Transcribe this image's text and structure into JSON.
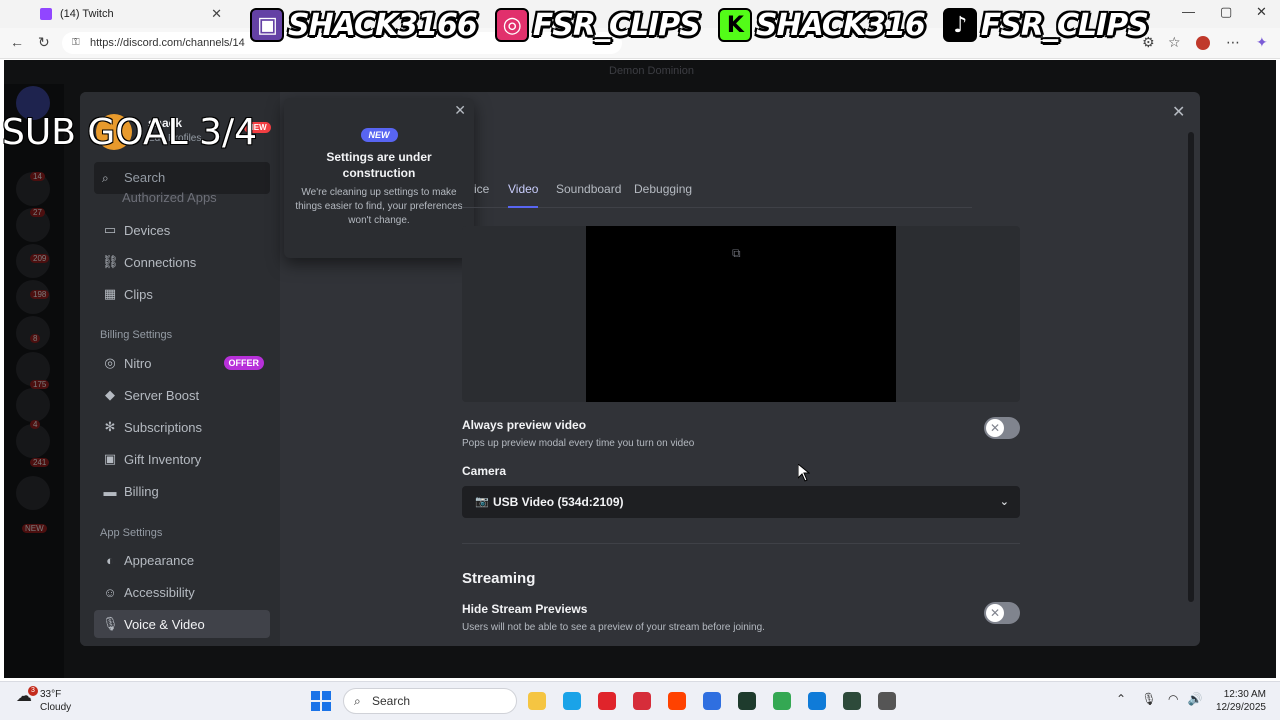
{
  "browser": {
    "tabs": [
      {
        "title": "(14) Twitch"
      }
    ],
    "url": "https://discord.com/channels/14"
  },
  "overlay": {
    "banner": [
      {
        "handle": "SHACK3166",
        "platform_icon": "twitch-icon",
        "color": "#6441a5"
      },
      {
        "handle": "FSR_CLIPS",
        "platform_icon": "instagram-icon",
        "color": "#e1306c"
      },
      {
        "handle": "SHACK316",
        "platform_icon": "kick-icon",
        "color": "#53fc18"
      },
      {
        "handle": "FSR_CLIPS",
        "platform_icon": "tiktok-icon",
        "color": "#000000"
      }
    ],
    "sub_goal": "SUB GOAL 3/4"
  },
  "discord": {
    "server_title": "Demon Dominion",
    "server_badges": [
      "14",
      "27",
      "209",
      "198",
      "8",
      "175",
      "4",
      "241",
      "NEW"
    ]
  },
  "settings": {
    "profile": {
      "name": "shack",
      "subtitle": "Edit Profiles",
      "new_label": "NEW"
    },
    "search_placeholder": "Search",
    "cut_item": "Authorized Apps",
    "nav_top": [
      {
        "label": "Devices",
        "icon": "devices-icon",
        "glyph": "▭"
      },
      {
        "label": "Connections",
        "icon": "link-icon",
        "glyph": "⛓"
      },
      {
        "label": "Clips",
        "icon": "clips-icon",
        "glyph": "▦"
      }
    ],
    "billing_section": "Billing Settings",
    "nav_billing": [
      {
        "label": "Nitro",
        "icon": "nitro-icon",
        "glyph": "◎",
        "badge": "OFFER"
      },
      {
        "label": "Server Boost",
        "icon": "boost-icon",
        "glyph": "◆"
      },
      {
        "label": "Subscriptions",
        "icon": "subscriptions-icon",
        "glyph": "✻"
      },
      {
        "label": "Gift Inventory",
        "icon": "gift-icon",
        "glyph": "▣"
      },
      {
        "label": "Billing",
        "icon": "card-icon",
        "glyph": "▬"
      }
    ],
    "app_section": "App Settings",
    "nav_app": [
      {
        "label": "Appearance",
        "icon": "palette-icon",
        "glyph": "◐"
      },
      {
        "label": "Accessibility",
        "icon": "accessibility-icon",
        "glyph": "☺"
      },
      {
        "label": "Voice & Video",
        "icon": "mic-icon",
        "glyph": "🎙",
        "active": true
      }
    ],
    "popover": {
      "badge": "NEW",
      "title": "Settings are under construction",
      "text": "We're cleaning up settings to make things easier to find, your preferences won't change."
    },
    "tabs": [
      {
        "label": "ice"
      },
      {
        "label": "Video",
        "active": true
      },
      {
        "label": "Soundboard"
      },
      {
        "label": "Debugging"
      }
    ],
    "always_preview": {
      "label": "Always preview video",
      "description": "Pops up preview modal every time you turn on video",
      "enabled": false
    },
    "camera": {
      "label": "Camera",
      "selected": "USB Video (534d:2109)"
    },
    "streaming": {
      "heading": "Streaming",
      "hide_previews_label": "Hide Stream Previews",
      "hide_previews_description": "Users will not be able to see a preview of your stream before joining.",
      "enabled": false
    }
  },
  "taskbar": {
    "weather_temp": "33°F",
    "weather_cond": "Cloudy",
    "weather_badge": "3",
    "search_label": "Search",
    "time": "12:30 AM",
    "date": "12/29/2025",
    "apps": [
      {
        "name": "file-explorer-icon",
        "color": "#f5c542"
      },
      {
        "name": "edge-icon",
        "color": "#1aa3e8"
      },
      {
        "name": "opera-icon",
        "color": "#e0242b"
      },
      {
        "name": "shield-app-icon",
        "color": "#d62d3a"
      },
      {
        "name": "red-app-icon",
        "color": "#ff4200"
      },
      {
        "name": "store-icon",
        "color": "#2f6fe0"
      },
      {
        "name": "terminal-icon",
        "color": "#1e3b2d"
      },
      {
        "name": "chrome-icon",
        "color": "#34a853"
      },
      {
        "name": "edge-active-icon",
        "color": "#0f7bd8"
      },
      {
        "name": "nvidia-icon",
        "color": "#2d4a3a"
      },
      {
        "name": "settings-app-icon",
        "color": "#555555"
      }
    ]
  }
}
